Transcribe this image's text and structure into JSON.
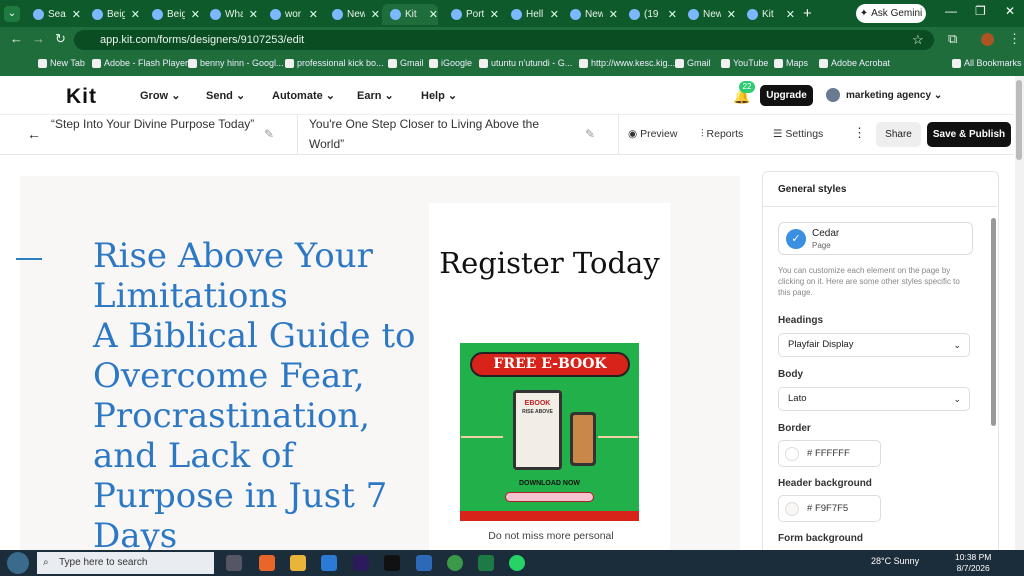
{
  "browser": {
    "tabs": [
      {
        "label": "Sea",
        "active": false
      },
      {
        "label": "Beig",
        "active": false
      },
      {
        "label": "Beig",
        "active": false
      },
      {
        "label": "Wha",
        "active": false
      },
      {
        "label": "wor",
        "active": false
      },
      {
        "label": "New",
        "active": false
      },
      {
        "label": "Kit",
        "active": true
      },
      {
        "label": "Port",
        "active": false
      },
      {
        "label": "Hell",
        "active": false
      },
      {
        "label": "New",
        "active": false
      },
      {
        "label": "(19",
        "active": false
      },
      {
        "label": "New",
        "active": false
      },
      {
        "label": "Kit",
        "active": false
      }
    ],
    "gemini_label": "Ask Gemini",
    "url": "app.kit.com/forms/designers/9107253/edit",
    "bookmarks": [
      "New Tab",
      "Adobe - Flash Player",
      "benny hinn - Googl...",
      "professional kick bo...",
      "Gmail",
      "iGoogle",
      "utuntu n'utundi - G...",
      "http://www.kesc.kig...",
      "Gmail",
      "YouTube",
      "Maps",
      "Adobe Acrobat"
    ],
    "all_bookmarks": "All Bookmarks"
  },
  "kit": {
    "logo": "Kit",
    "menu": [
      "Grow",
      "Send",
      "Automate",
      "Earn",
      "Help"
    ],
    "notif_count": "22",
    "upgrade": "Upgrade",
    "account": "marketing agency"
  },
  "toolbar": {
    "title1": "“Step Into Your Divine Purpose Today”",
    "title2": "You're One Step Closer to Living Above the World”",
    "preview": "Preview",
    "reports": "Reports",
    "settings": "Settings",
    "share": "Share",
    "save_publish": "Save & Publish"
  },
  "canvas": {
    "headline": "Rise Above Your Limitations\nA Biblical Guide to Overcome Fear, Procrastination, and Lack of Purpose in Just 7 Days",
    "register": "Register Today",
    "ebook_banner": "FREE E-BOOK",
    "ebook_title": "EBOOK",
    "ebook_sub": "RISE ABOVE",
    "download": "DOWNLOAD NOW",
    "description": "Do not miss more personal"
  },
  "panel": {
    "heading": "General styles",
    "theme_name": "Cedar",
    "theme_sub": "Page",
    "help": "You can customize each element on the page by clicking on it. Here are some other styles specific to this page.",
    "headings_label": "Headings",
    "headings_value": "Playfair Display",
    "body_label": "Body",
    "body_value": "Lato",
    "border_label": "Border",
    "border_value": "FFFFFF",
    "header_bg_label": "Header background",
    "header_bg_value": "F9F7F5",
    "form_bg_label": "Form background"
  },
  "taskbar": {
    "search": "Type here to search",
    "weather": "28°C  Sunny",
    "time": "10:38 PM",
    "date": "8/7/2026"
  },
  "colors": {
    "browser_green": "#1f6d3a",
    "headline_blue": "#2d78c4",
    "ebook_green": "#22b04b",
    "ebook_red": "#d7231a"
  }
}
